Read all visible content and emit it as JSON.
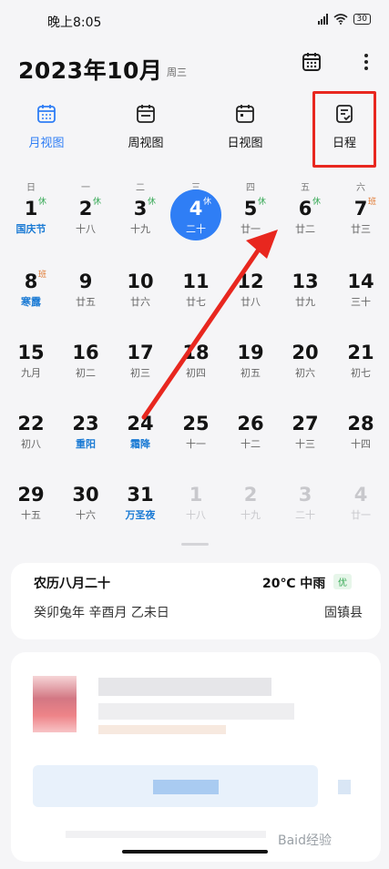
{
  "status_bar": {
    "time": "晚上8:05",
    "battery": "30"
  },
  "header": {
    "title": "2023年10月",
    "weekday": "周三"
  },
  "tabs": [
    {
      "label": "月视图",
      "icon": "month-calendar-icon",
      "active": true
    },
    {
      "label": "周视图",
      "icon": "week-calendar-icon",
      "active": false
    },
    {
      "label": "日视图",
      "icon": "day-calendar-icon",
      "active": false
    },
    {
      "label": "日程",
      "icon": "agenda-icon",
      "active": false
    }
  ],
  "week_days": [
    "日",
    "一",
    "二",
    "三",
    "四",
    "五",
    "六"
  ],
  "weeks": [
    [
      {
        "day": "1",
        "sub": "国庆节",
        "holiday": true,
        "tag": "休"
      },
      {
        "day": "2",
        "sub": "十八",
        "tag": "休"
      },
      {
        "day": "3",
        "sub": "十九",
        "tag": "休"
      },
      {
        "day": "4",
        "sub": "二十",
        "tag": "休",
        "today": true
      },
      {
        "day": "5",
        "sub": "廿一",
        "tag": "休"
      },
      {
        "day": "6",
        "sub": "廿二",
        "tag": "休"
      },
      {
        "day": "7",
        "sub": "廿三",
        "tag": "班"
      }
    ],
    [
      {
        "day": "8",
        "sub": "寒露",
        "holiday": true,
        "tag": "班"
      },
      {
        "day": "9",
        "sub": "廿五"
      },
      {
        "day": "10",
        "sub": "廿六"
      },
      {
        "day": "11",
        "sub": "廿七"
      },
      {
        "day": "12",
        "sub": "廿八"
      },
      {
        "day": "13",
        "sub": "廿九"
      },
      {
        "day": "14",
        "sub": "三十"
      }
    ],
    [
      {
        "day": "15",
        "sub": "九月"
      },
      {
        "day": "16",
        "sub": "初二"
      },
      {
        "day": "17",
        "sub": "初三"
      },
      {
        "day": "18",
        "sub": "初四"
      },
      {
        "day": "19",
        "sub": "初五"
      },
      {
        "day": "20",
        "sub": "初六"
      },
      {
        "day": "21",
        "sub": "初七"
      }
    ],
    [
      {
        "day": "22",
        "sub": "初八"
      },
      {
        "day": "23",
        "sub": "重阳",
        "holiday": true
      },
      {
        "day": "24",
        "sub": "霜降",
        "holiday": true
      },
      {
        "day": "25",
        "sub": "十一"
      },
      {
        "day": "26",
        "sub": "十二"
      },
      {
        "day": "27",
        "sub": "十三"
      },
      {
        "day": "28",
        "sub": "十四"
      }
    ],
    [
      {
        "day": "29",
        "sub": "十五"
      },
      {
        "day": "30",
        "sub": "十六"
      },
      {
        "day": "31",
        "sub": "万圣夜",
        "holiday": true
      },
      {
        "day": "1",
        "sub": "十八",
        "other": true
      },
      {
        "day": "2",
        "sub": "十九",
        "other": true
      },
      {
        "day": "3",
        "sub": "二十",
        "other": true
      },
      {
        "day": "4",
        "sub": "廿一",
        "other": true
      }
    ]
  ],
  "info_card": {
    "lunar_date": "农历八月二十",
    "ganzhi": "癸卯兔年 辛酉月 乙未日",
    "weather": "20℃ 中雨",
    "air_quality": "优",
    "location": "固镇县"
  },
  "watermark": "Baid经验",
  "colors": {
    "accent": "#2f7ef5",
    "rest_tag": "#34a853",
    "work_tag": "#e0762c",
    "annotation_red": "#e8271f"
  }
}
